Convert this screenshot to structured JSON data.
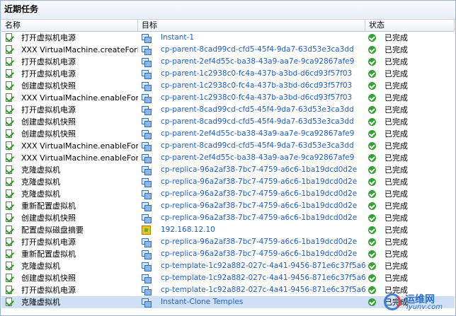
{
  "panel_title": "近期任务",
  "columns": {
    "name": "名称",
    "target": "目标",
    "status": "状态"
  },
  "rows": [
    {
      "name": "打开虚拟机电源",
      "target": "Instant-1",
      "target_icon": "vm-icon",
      "status": "已完成"
    },
    {
      "name": "XXX VirtualMachine.createFork...",
      "target": "cp-parent-8cad99cd-cfd5-45f4-9da7-63d53e3ca3dd",
      "target_icon": "vm-icon",
      "status": "已完成"
    },
    {
      "name": "打开虚拟机电源",
      "target": "cp-parent-2ef4d55c-ba38-43a9-aa7e-9ca92867afe9",
      "target_icon": "vm-icon",
      "status": "已完成"
    },
    {
      "name": "打开虚拟机电源",
      "target": "cp-parent-1c2938c0-fc4a-437b-a3bd-d6cd93f57f03",
      "target_icon": "vm-icon",
      "status": "已完成"
    },
    {
      "name": "创建虚拟机快照",
      "target": "cp-parent-1c2938c0-fc4a-437b-a3bd-d6cd93f57f03",
      "target_icon": "vm-icon",
      "status": "已完成"
    },
    {
      "name": "XXX VirtualMachine.enableFork...",
      "target": "cp-parent-1c2938c0-fc4a-437b-a3bd-d6cd93f57f03",
      "target_icon": "vm-icon",
      "status": "已完成"
    },
    {
      "name": "打开虚拟机电源",
      "target": "cp-parent-8cad99cd-cfd5-45f4-9da7-63d53e3ca3dd",
      "target_icon": "vm-icon",
      "status": "已完成"
    },
    {
      "name": "创建虚拟机快照",
      "target": "cp-parent-8cad99cd-cfd5-45f4-9da7-63d53e3ca3dd",
      "target_icon": "vm-icon",
      "status": "已完成"
    },
    {
      "name": "创建虚拟机快照",
      "target": "cp-parent-2ef4d55c-ba38-43a9-aa7e-9ca92867afe9",
      "target_icon": "vm-icon",
      "status": "已完成"
    },
    {
      "name": "XXX VirtualMachine.enableFork...",
      "target": "cp-parent-8cad99cd-cfd5-45f4-9da7-63d53e3ca3dd",
      "target_icon": "vm-icon",
      "status": "已完成"
    },
    {
      "name": "XXX VirtualMachine.enableFork...",
      "target": "cp-parent-2ef4d55c-ba38-43a9-aa7e-9ca92867afe9",
      "target_icon": "vm-icon",
      "status": "已完成"
    },
    {
      "name": "克隆虚拟机",
      "target": "cp-replica-96a2af38-7bc7-4759-a6c6-1ba19dcd0d2e",
      "target_icon": "vm-icon",
      "status": "已完成"
    },
    {
      "name": "克隆虚拟机",
      "target": "cp-replica-96a2af38-7bc7-4759-a6c6-1ba19dcd0d2e",
      "target_icon": "vm-icon",
      "status": "已完成"
    },
    {
      "name": "克隆虚拟机",
      "target": "cp-replica-96a2af38-7bc7-4759-a6c6-1ba19dcd0d2e",
      "target_icon": "vm-icon",
      "status": "已完成"
    },
    {
      "name": "重新配置虚拟机",
      "target": "cp-replica-96a2af38-7bc7-4759-a6c6-1ba19dcd0d2e",
      "target_icon": "vm-icon",
      "status": "已完成"
    },
    {
      "name": "创建虚拟机快照",
      "target": "cp-replica-96a2af38-7bc7-4759-a6c6-1ba19dcd0d2e",
      "target_icon": "vm-icon",
      "status": "已完成"
    },
    {
      "name": "配置虚拟磁盘摘要",
      "target": "192.168.12.10",
      "target_icon": "host-icon",
      "status": "已完成"
    },
    {
      "name": "打开虚拟机电源",
      "target": "cp-replica-96a2af38-7bc7-4759-a6c6-1ba19dcd0d2e",
      "target_icon": "vm-icon",
      "status": "已完成"
    },
    {
      "name": "重新配置虚拟机",
      "target": "cp-replica-96a2af38-7bc7-4759-a6c6-1ba19dcd0d2e",
      "target_icon": "vm-icon",
      "status": "已完成"
    },
    {
      "name": "克隆虚拟机",
      "target": "cp-template-1c92a882-027c-4a41-9456-871e6c37f5a6",
      "target_icon": "vm-icon",
      "status": "已完成"
    },
    {
      "name": "创建虚拟机快照",
      "target": "cp-template-1c92a882-027c-4a41-9456-871e6c37f5a6",
      "target_icon": "vm-icon",
      "status": "已完成"
    },
    {
      "name": "打开虚拟机电源",
      "target": "cp-template-1c92a882-027c-4a41-9456-871e6c37f5a6",
      "target_icon": "vm-icon",
      "status": "已完成"
    },
    {
      "name": "克隆虚拟机",
      "target": "Instant-Clone Temples",
      "target_icon": "vm-icon",
      "status": "已完成"
    }
  ],
  "selected_row": 22,
  "watermark": {
    "title": "运维网",
    "url": "iyunv.com"
  }
}
